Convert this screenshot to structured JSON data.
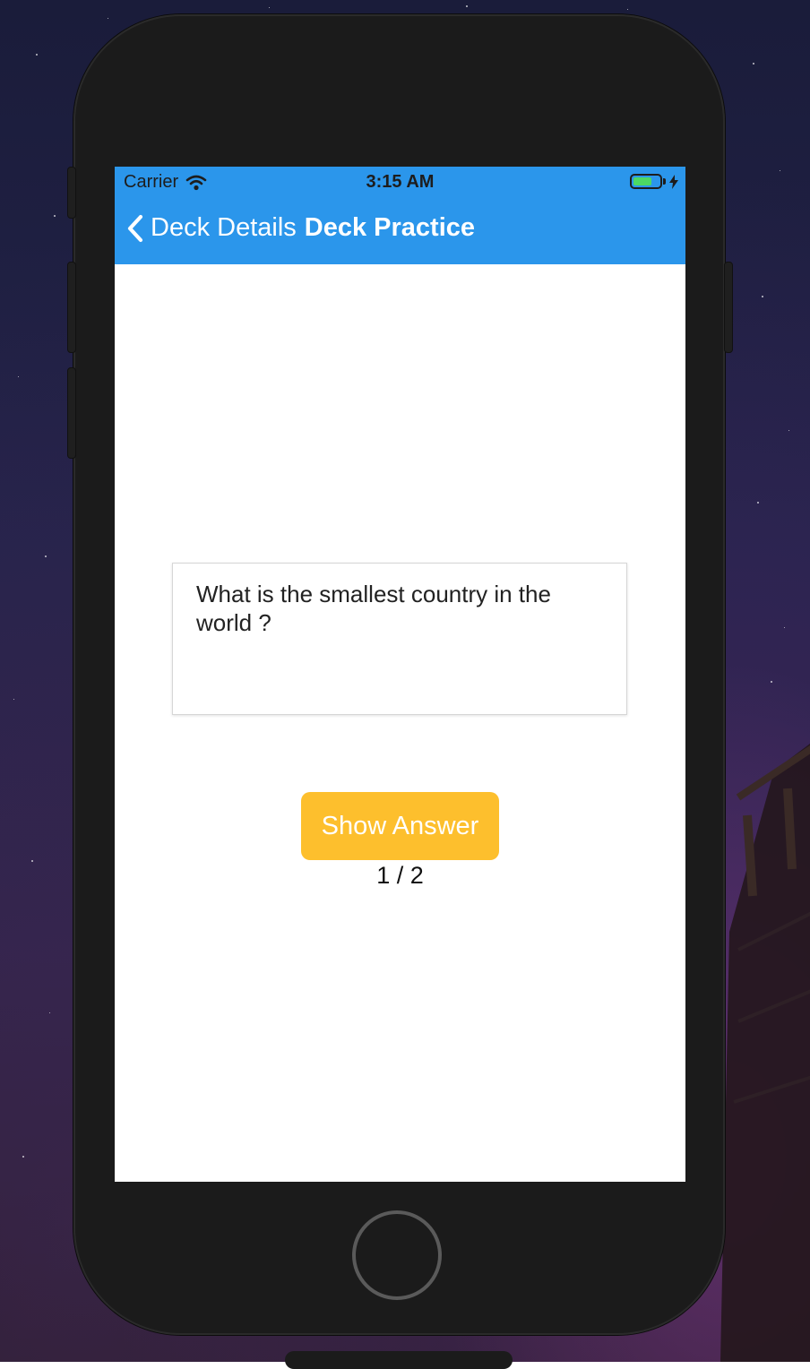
{
  "status_bar": {
    "carrier": "Carrier",
    "time": "3:15 AM",
    "wifi_icon": "wifi-icon",
    "battery_icon": "battery-charging-icon"
  },
  "nav": {
    "back_icon": "chevron-left-icon",
    "back_label": "Deck Details",
    "title": "Deck Practice"
  },
  "card": {
    "question": "What is the smallest country in the world ?"
  },
  "actions": {
    "show_answer_label": "Show Answer"
  },
  "progress": {
    "counter": "1 / 2"
  },
  "colors": {
    "header": "#2b96eb",
    "button": "#fdbf2d",
    "battery": "#4cd964"
  }
}
